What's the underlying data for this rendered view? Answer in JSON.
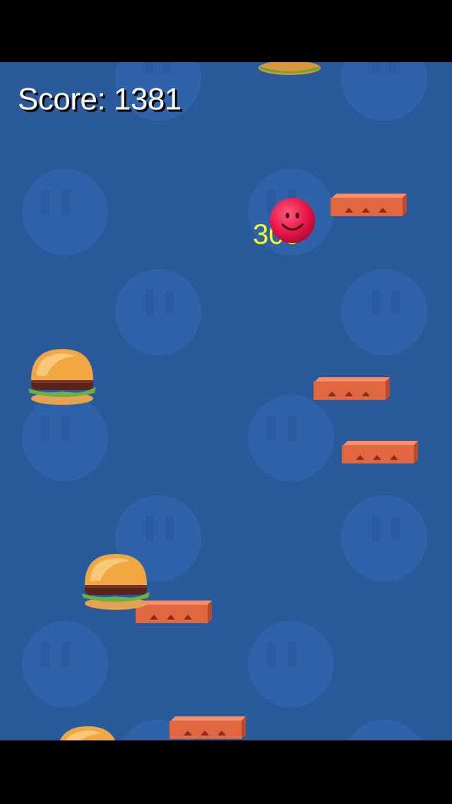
{
  "hud": {
    "score_text": "Score: 1381"
  },
  "popup": {
    "points_text": "300"
  },
  "colors": {
    "sky": "#2b5a9a",
    "bg_face": "#2f62a8",
    "platform": "#e0673f",
    "ball": "#e8174a",
    "popup": "#ffff22"
  },
  "icons": {
    "player": "smiley-ball-icon",
    "pickup": "burger-icon",
    "platform": "brick-platform",
    "background": "smiley-face-pattern"
  }
}
